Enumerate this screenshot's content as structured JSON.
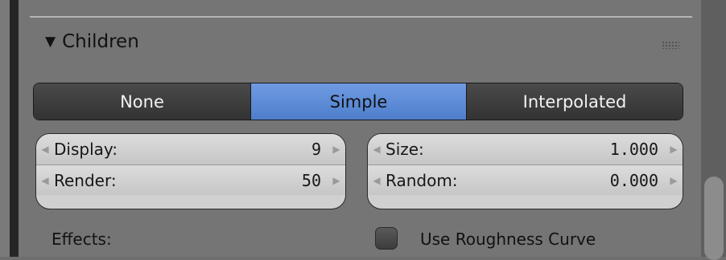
{
  "panel": {
    "title": "Children",
    "collapse_state": "expanded"
  },
  "mode_selector": {
    "options": [
      "None",
      "Simple",
      "Interpolated"
    ],
    "selected": "Simple"
  },
  "left_fields": [
    {
      "label": "Display:",
      "value": "9"
    },
    {
      "label": "Render:",
      "value": "50"
    }
  ],
  "right_fields": [
    {
      "label": "Size:",
      "value": "1.000"
    },
    {
      "label": "Random:",
      "value": "0.000"
    }
  ],
  "effects": {
    "label": "Effects:",
    "checkbox_label": "Use Roughness Curve",
    "checkbox_checked": false
  }
}
